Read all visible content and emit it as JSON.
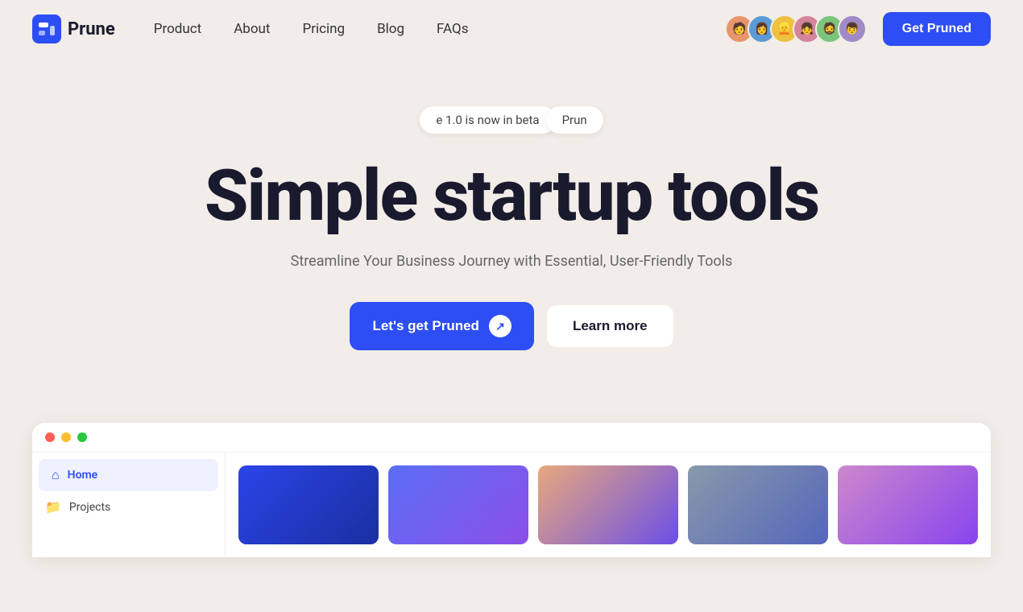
{
  "nav": {
    "logo_text": "Prune",
    "links": [
      {
        "label": "Product",
        "id": "product"
      },
      {
        "label": "About",
        "id": "about"
      },
      {
        "label": "Pricing",
        "id": "pricing"
      },
      {
        "label": "Blog",
        "id": "blog"
      },
      {
        "label": "FAQs",
        "id": "faqs"
      }
    ],
    "cta_label": "Get Pruned"
  },
  "hero": {
    "beta_badge_left": "e 1.0 is now in beta",
    "beta_badge_right": "Prun",
    "title": "Simple startup tools",
    "subtitle": "Streamline Your Business Journey with Essential, User-Friendly Tools",
    "cta_primary": "Let's get Pruned",
    "cta_secondary": "Learn more"
  },
  "app_preview": {
    "sidebar_items": [
      {
        "label": "Home",
        "active": true
      },
      {
        "label": "Projects",
        "active": false
      }
    ]
  },
  "colors": {
    "accent": "#2d4ef5",
    "background": "#f2ede8"
  }
}
